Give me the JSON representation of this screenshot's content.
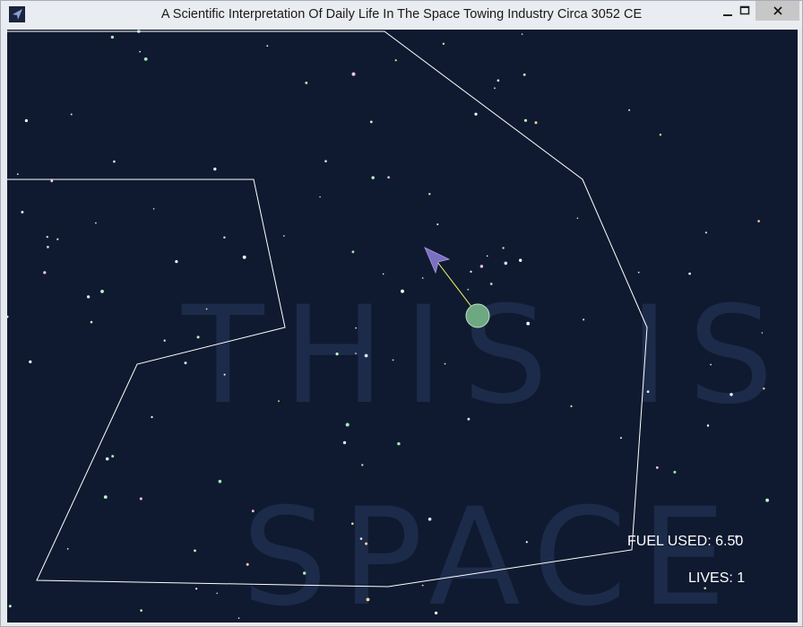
{
  "window": {
    "title": "A Scientific Interpretation Of Daily Life In The Space Towing Industry Circa 3052 CE",
    "icons": {
      "app": "arrow-ship-icon",
      "minimize": "minimize-icon",
      "maximize": "maximize-icon",
      "close": "close-icon"
    }
  },
  "game": {
    "background_color": "#0f1a30",
    "watermark_line1": "THIS IS",
    "watermark_line2": "SPACE",
    "hud": {
      "fuel_label": "FUEL USED:",
      "fuel_value": "6.50",
      "lives_label": "LIVES:",
      "lives_value": "1"
    },
    "colors": {
      "boundary": "#ffffff",
      "ship": "#7a6fc0",
      "tow_line": "#ffff66",
      "cargo": "#6ea882"
    }
  }
}
